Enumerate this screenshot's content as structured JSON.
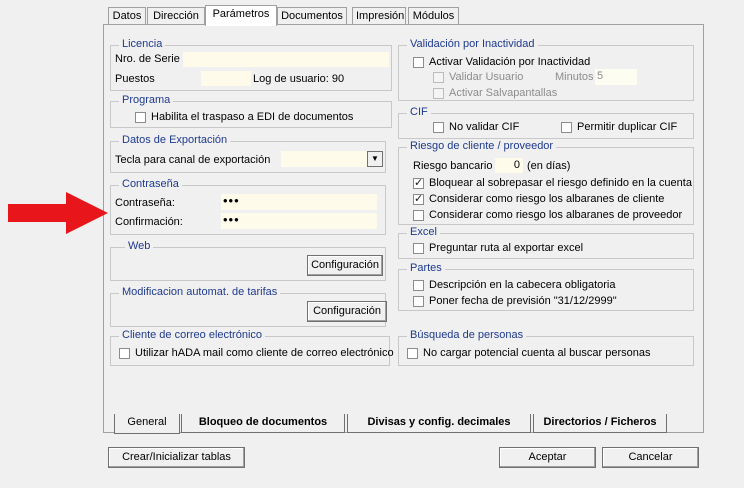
{
  "tabs": [
    {
      "label": "Datos",
      "underline": "D",
      "rest": "atos"
    },
    {
      "label": "Dirección",
      "underline": "",
      "rest": "Dirección"
    },
    {
      "label": "Parámetros",
      "underline": "P",
      "rest": "arámetros"
    },
    {
      "label": "Documentos",
      "underline": "D",
      "rest": "ocumentos"
    },
    {
      "label": "Impresión",
      "underline": "I",
      "rest": "mpresión"
    },
    {
      "label": "Módulos",
      "underline": "",
      "rest": "Módulos"
    }
  ],
  "licencia": {
    "title": "Licencia",
    "serie_label": "Nro. de Serie",
    "puestos_label": "Puestos",
    "log_label": "Log de usuario: 90"
  },
  "programa": {
    "title": "Programa",
    "edi": "Habilita el traspaso a EDI de documentos"
  },
  "exportacion": {
    "title": "Datos de Exportación",
    "tecla_label": "Tecla para canal de exportación"
  },
  "contrasena": {
    "title": "Contraseña",
    "pass_label": "Contraseña:",
    "pass_value": "•••",
    "confirm_label": "Confirmación:",
    "confirm_value": "•••"
  },
  "web": {
    "title": "Web",
    "config_btn": "Configuración"
  },
  "tarifas": {
    "title": "Modificacion automat. de tarifas",
    "config_btn": "Configuración"
  },
  "correo": {
    "title": "Cliente de correo electrónico",
    "hada": "Utilizar hADA mail como cliente de correo electrónico"
  },
  "inactividad": {
    "title": "Validación por Inactividad",
    "activar": "Activar Validación por Inactividad",
    "validar": "Validar Usuario",
    "minutos_label": "Minutos",
    "minutos_value": "5",
    "salvapantallas": "Activar Salvapantallas"
  },
  "cif": {
    "title": "CIF",
    "no_validar": "No validar CIF",
    "permitir": "Permitir duplicar CIF"
  },
  "riesgo": {
    "title": "Riesgo de cliente / proveedor",
    "bancario_label": "Riesgo bancario",
    "bancario_value": "0",
    "dias": "(en días)",
    "bloquear": "Bloquear al sobrepasar el riesgo definido en la cuenta",
    "alb_cliente": "Considerar como riesgo los albaranes de cliente",
    "alb_proveedor": "Considerar como riesgo los albaranes de proveedor"
  },
  "excel": {
    "title": "Excel",
    "preguntar": "Preguntar ruta al exportar excel"
  },
  "partes": {
    "title": "Partes",
    "descripcion": "Descripción en la cabecera obligatoria",
    "fecha": "Poner fecha de previsión \"31/12/2999\""
  },
  "busqueda": {
    "title": "Búsqueda de personas",
    "no_cargar": "No cargar potencial cuenta al buscar personas"
  },
  "bottom_tabs": [
    "General",
    "Bloqueo de documentos",
    "Divisas y config. decimales",
    "Directorios / Ficheros"
  ],
  "buttons": {
    "crear": "Crear/Inicializar tablas",
    "aceptar": "Aceptar",
    "cancelar": "Cancelar"
  },
  "checkbox_states": {
    "edi": false,
    "hada": false,
    "activar": false,
    "validar": false,
    "salvapantallas": false,
    "no_validar": false,
    "permitir": false,
    "bloquear": true,
    "alb_cliente": true,
    "alb_proveedor": false,
    "preguntar": false,
    "descripcion": false,
    "fecha": false,
    "no_cargar": false
  },
  "colors": {
    "accent": "#1e3a8c",
    "field": "#fffbea",
    "arrow": "#e8151b"
  }
}
